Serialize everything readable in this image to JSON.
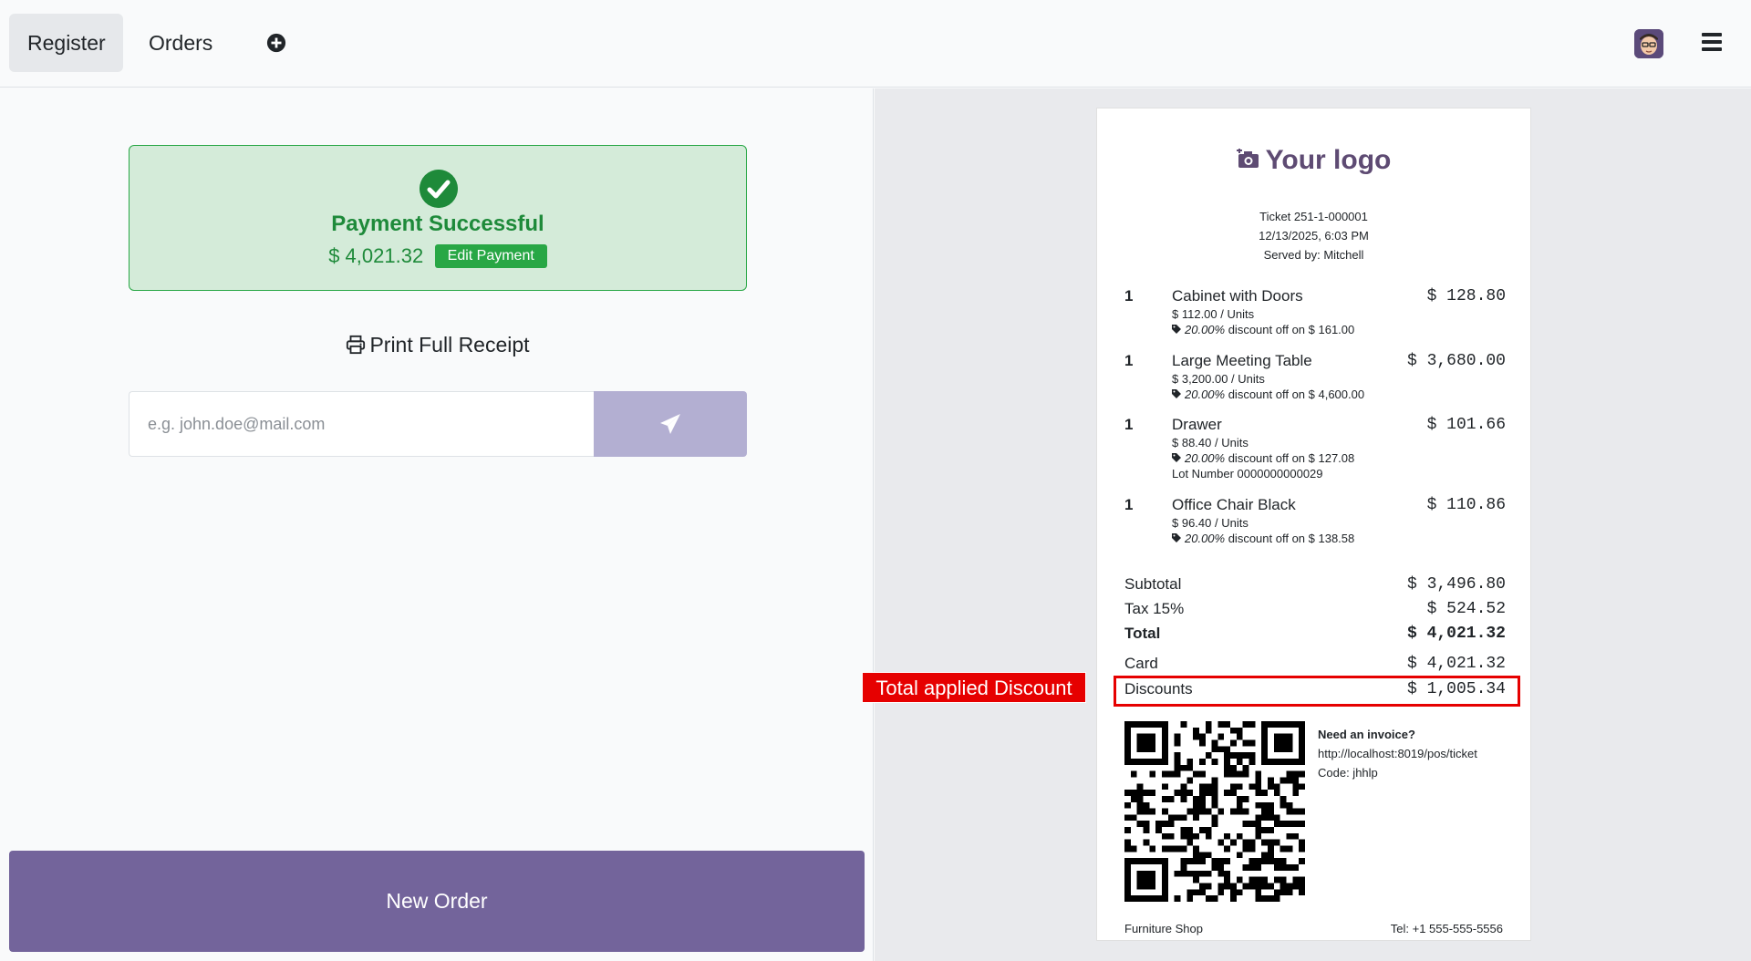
{
  "topbar": {
    "tabs": [
      {
        "label": "Register",
        "active": true
      },
      {
        "label": "Orders",
        "active": false
      }
    ]
  },
  "payment": {
    "title": "Payment Successful",
    "amount": "$ 4,021.32",
    "edit_label": "Edit Payment",
    "print_label": "Print Full Receipt",
    "email_placeholder": "e.g. john.doe@mail.com",
    "new_order_label": "New Order"
  },
  "receipt": {
    "logo_text": "Your logo",
    "ticket": "Ticket 251-1-000001",
    "datetime": "12/13/2025, 6:03 PM",
    "served_by": "Served by: Mitchell",
    "lines": [
      {
        "qty": "1",
        "name": "Cabinet with Doors",
        "price": "$ 128.80",
        "unit": "$ 112.00 / Units",
        "discount_pct": "20.00%",
        "discount_text": " discount off on $ 161.00",
        "lot": ""
      },
      {
        "qty": "1",
        "name": "Large Meeting Table",
        "price": "$ 3,680.00",
        "unit": "$ 3,200.00 / Units",
        "discount_pct": "20.00%",
        "discount_text": " discount off on $ 4,600.00",
        "lot": ""
      },
      {
        "qty": "1",
        "name": "Drawer",
        "price": "$ 101.66",
        "unit": "$ 88.40 / Units",
        "discount_pct": "20.00%",
        "discount_text": " discount off on $ 127.08",
        "lot": "Lot Number 0000000000029"
      },
      {
        "qty": "1",
        "name": "Office Chair Black",
        "price": "$ 110.86",
        "unit": "$ 96.40 / Units",
        "discount_pct": "20.00%",
        "discount_text": " discount off on $ 138.58",
        "lot": ""
      }
    ],
    "totals": {
      "subtotal_label": "Subtotal",
      "subtotal": "$ 3,496.80",
      "tax_label": "Tax 15%",
      "tax": "$ 524.52",
      "total_label": "Total",
      "total": "$ 4,021.32",
      "card_label": "Card",
      "card": "$ 4,021.32",
      "discounts_label": "Discounts",
      "discounts": "$ 1,005.34"
    },
    "invoice": {
      "title": "Need an invoice?",
      "url": "http://localhost:8019/pos/ticket",
      "code": "Code: jhhlp"
    },
    "footer_left": "Furniture Shop",
    "footer_right": "Tel: +1 555-555-5556"
  },
  "annotation": {
    "label": "Total applied Discount",
    "color": "#e60000"
  },
  "colors": {
    "success_green": "#1e8a3a",
    "primary_purple": "#73649b",
    "send_button": "#b3afd2",
    "logo_purple": "#5e4b73"
  }
}
